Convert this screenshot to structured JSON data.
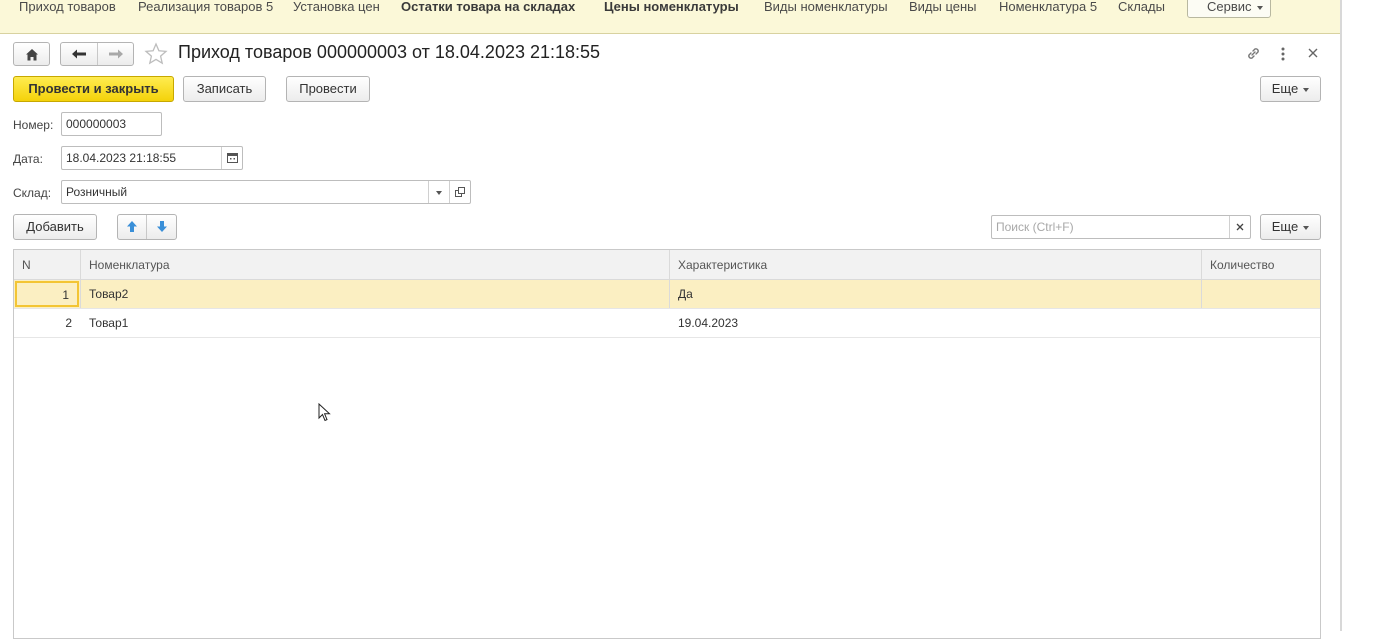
{
  "sections": [
    "Приход товаров",
    "Реализация товаров 5",
    "Установка цен",
    "Остатки товара на складах",
    "Цены номенклатуры",
    "Виды номенклатуры",
    "Виды цены",
    "Номенклатура 5",
    "Склады"
  ],
  "service_label": "Сервис",
  "form": {
    "title": "Приход товаров 000000003 от 18.04.2023 21:18:55",
    "post_close_label": "Провести и закрыть",
    "save_label": "Записать",
    "post_label": "Провести",
    "more_label": "Еще",
    "number_label": "Номер:",
    "number_value": "000000003",
    "date_label": "Дата:",
    "date_value": "18.04.2023 21:18:55",
    "warehouse_label": "Склад:",
    "warehouse_value": "Розничный"
  },
  "table_toolbar": {
    "add_label": "Добавить",
    "search_placeholder": "Поиск (Ctrl+F)",
    "more_label": "Еще"
  },
  "table": {
    "columns": [
      "N",
      "Номенклатура",
      "Характеристика",
      "Количество"
    ],
    "rows": [
      {
        "n": "1",
        "item": "Товар2",
        "characteristic": "Да",
        "quantity": ""
      },
      {
        "n": "2",
        "item": "Товар1",
        "characteristic": "19.04.2023",
        "quantity": ""
      }
    ]
  },
  "colors": {
    "accent": "#f4d20a",
    "nav_bg": "#fbf8d8",
    "selected_row": "#fbefc2"
  },
  "icons": [
    "home-icon",
    "back-arrow-icon",
    "forward-arrow-icon",
    "star-icon",
    "link-icon",
    "kebab-menu-icon",
    "close-icon",
    "calendar-icon",
    "dropdown-arrow-icon",
    "open-icon",
    "move-up-icon",
    "move-down-icon",
    "clear-icon",
    "mouse-cursor-icon"
  ]
}
